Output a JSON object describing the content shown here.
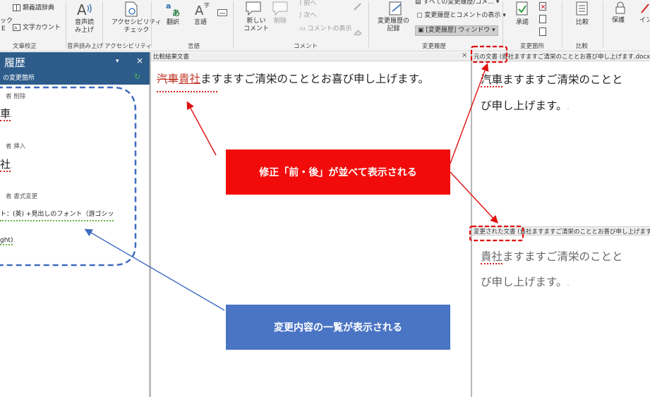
{
  "ribbon": {
    "thesaurus": "類義語辞典",
    "word_count": "文字カウント",
    "check_partial_1": "ック",
    "check_partial_2": "E",
    "read_aloud": "音声読\nみ上げ",
    "accessibility": "アクセシビリティ\nチェック",
    "translate": "翻訳",
    "language": "言語",
    "new_comment": "新しい\nコメント",
    "delete": "削除",
    "prev": "前へ",
    "next": "次へ",
    "show_comments": "コメントの表示",
    "track_changes": "変更履歴の\n記録",
    "all_markup": "すべての変更履歴/コメ...",
    "show_markup": "変更履歴とコメントの表示",
    "reviewing_pane": "[変更履歴] ウィンドウ",
    "accept": "承諾",
    "compare": "比較",
    "protect": "保護",
    "ink_partial": "イン",
    "groups": {
      "proofing": "文章校正",
      "speech": "音声読み上げ",
      "accessibility": "アクセシビリティ",
      "language": "言語",
      "comments": "コメント",
      "tracking": "変更履歴",
      "changes": "変更箇所",
      "compare": "比較"
    }
  },
  "pane": {
    "title": "履歴",
    "subtitle": "の変更箇所",
    "items": [
      {
        "type": "者 削除",
        "text": "車"
      },
      {
        "type": "者 挿入",
        "text": "社"
      },
      {
        "type": "者 書式変更",
        "text": "ト：(英) +見出しのフォント（游ゴシッ"
      },
      {
        "type": "",
        "text": "ght)"
      }
    ]
  },
  "compared": {
    "title": "比較結果文書",
    "deleted": "汽車",
    "inserted": "貴社",
    "rest": "ますますご清栄のこととお喜び申し上げます。"
  },
  "original": {
    "title": "元の文書 (貴社ますますご清栄のこととお喜び申し上げます.docx - 一正",
    "line1_mark": "汽車",
    "line1_rest": "ますますご清栄のことと",
    "line2": "び申し上げます。"
  },
  "revised": {
    "title": "変更された文書 (貴社ますますご清栄のこととお喜び申し上げます（修正",
    "line1_mark": "貴社",
    "line1_rest": "ますますご清栄のことと",
    "line2": "び申し上げます。"
  },
  "callouts": {
    "red": "修正「前・後」が並べて表示される",
    "blue": "変更内容の一覧が表示される"
  },
  "colors": {
    "callout_red": "#f20b0b",
    "callout_blue": "#4a74c4",
    "pane_header": "#2d5c8a",
    "change_red": "#c0392b"
  }
}
